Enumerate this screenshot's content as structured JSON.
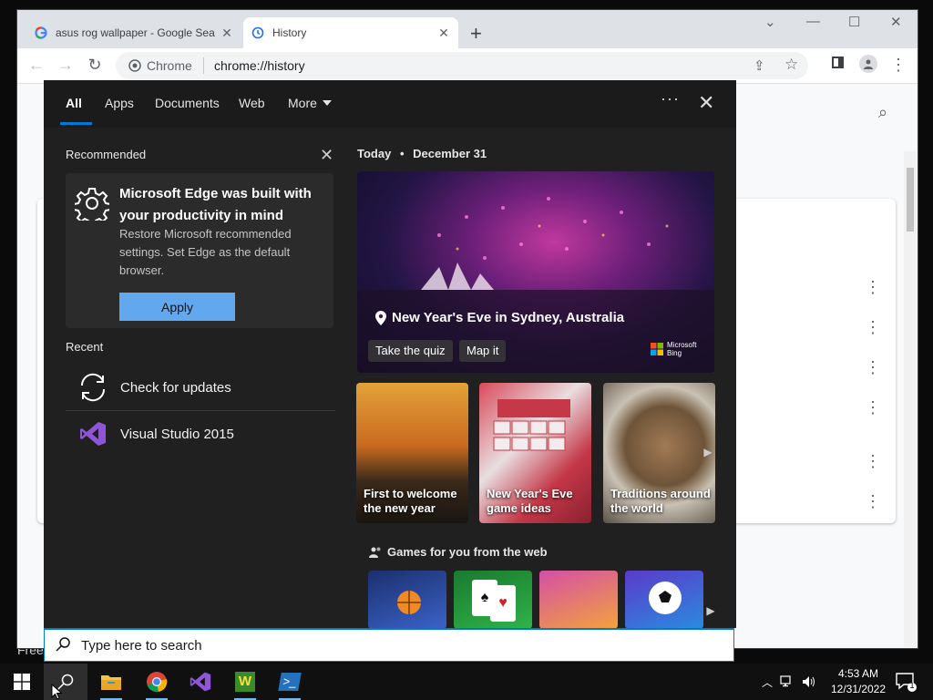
{
  "browser": {
    "tabs": [
      {
        "title": "asus rog wallpaper - Google Sea",
        "close": "✕"
      },
      {
        "title": "History",
        "close": "✕"
      }
    ],
    "new_tab": "+",
    "omnibox": {
      "site_label": "Chrome",
      "url": "chrome://history"
    }
  },
  "panel": {
    "tabs": [
      "All",
      "Apps",
      "Documents",
      "Web",
      "More"
    ],
    "recommended": {
      "title": "Recommended",
      "card_heading": "Microsoft Edge was built with your productivity in mind",
      "card_body": "Restore Microsoft recommended settings. Set Edge as the default browser.",
      "apply_label": "Apply"
    },
    "recent": {
      "title": "Recent",
      "items": [
        {
          "label": "Check for updates"
        },
        {
          "label": "Visual Studio 2015"
        }
      ]
    },
    "today": {
      "label": "Today",
      "date": "December 31",
      "hero_caption": "New Year's Eve in Sydney, Australia",
      "quiz_label": "Take the quiz",
      "map_label": "Map it",
      "bing_label_1": "Microsoft",
      "bing_label_2": "Bing"
    },
    "tiles": [
      {
        "label": "First to welcome the new year"
      },
      {
        "label": "New Year's Eve game ideas"
      },
      {
        "label": "Traditions around the world"
      }
    ],
    "games_title": "Games for you from the web"
  },
  "search": {
    "placeholder": "Type here to search"
  },
  "desktop": {
    "text": "Free"
  },
  "taskbar": {
    "time": "4:53 AM",
    "date": "12/31/2022",
    "notification_count": "1"
  },
  "colors": {
    "accent": "#0078d4",
    "apply_button": "#62a8ef",
    "panel_bg": "#202020"
  }
}
